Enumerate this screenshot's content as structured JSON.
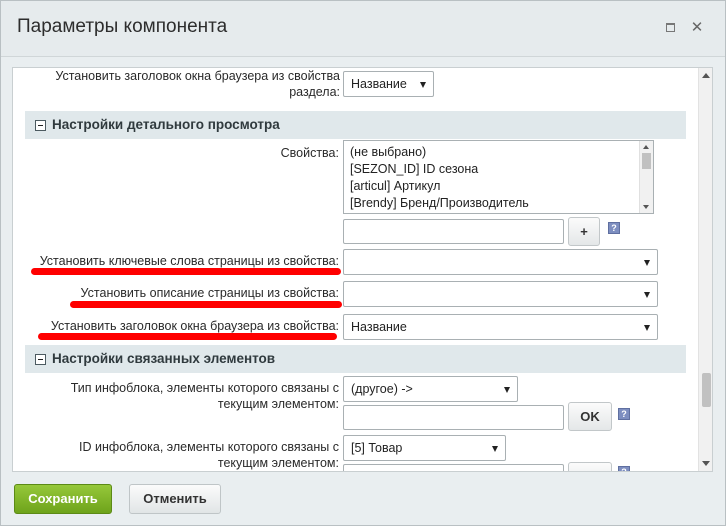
{
  "dialog": {
    "title": "Параметры компонента",
    "controls": {
      "maximize_icon": "maximize-icon",
      "close_icon": "close-icon"
    }
  },
  "rows": {
    "browser_title_section": {
      "label": "Установить заголовок окна браузера из свойства раздела:",
      "value": "Название"
    },
    "properties": {
      "label": "Свойства:",
      "options": [
        "(не выбрано)",
        "[SEZON_ID] ID сезона",
        "[articul] Артикул",
        "[Brendy] Бренд/Производитель"
      ],
      "add_button": "+",
      "help": "?"
    },
    "keywords": {
      "label": "Установить ключевые слова страницы из свойства:",
      "value": ""
    },
    "description": {
      "label": "Установить описание страницы из свойства:",
      "value": ""
    },
    "browser_title": {
      "label": "Установить заголовок окна браузера из свойства:",
      "value": "Название"
    },
    "link_iblock_type": {
      "label": "Тип инфоблока, элементы которого связаны с текущим элементом:",
      "value": "(другое) ->",
      "ok": "OK",
      "help": "?"
    },
    "link_iblock_id": {
      "label": "ID инфоблока, элементы которого связаны с текущим элементом:",
      "value": "[5] Товар",
      "ok": "OK",
      "help": "?"
    }
  },
  "sections": {
    "detail": "Настройки детального просмотра",
    "linked": "Настройки связанных элементов"
  },
  "footer": {
    "save": "Сохранить",
    "cancel": "Отменить"
  },
  "colors": {
    "save_button": "#7fb32a",
    "annotation": "#ff0000",
    "section_bg": "#e0e8eb"
  }
}
